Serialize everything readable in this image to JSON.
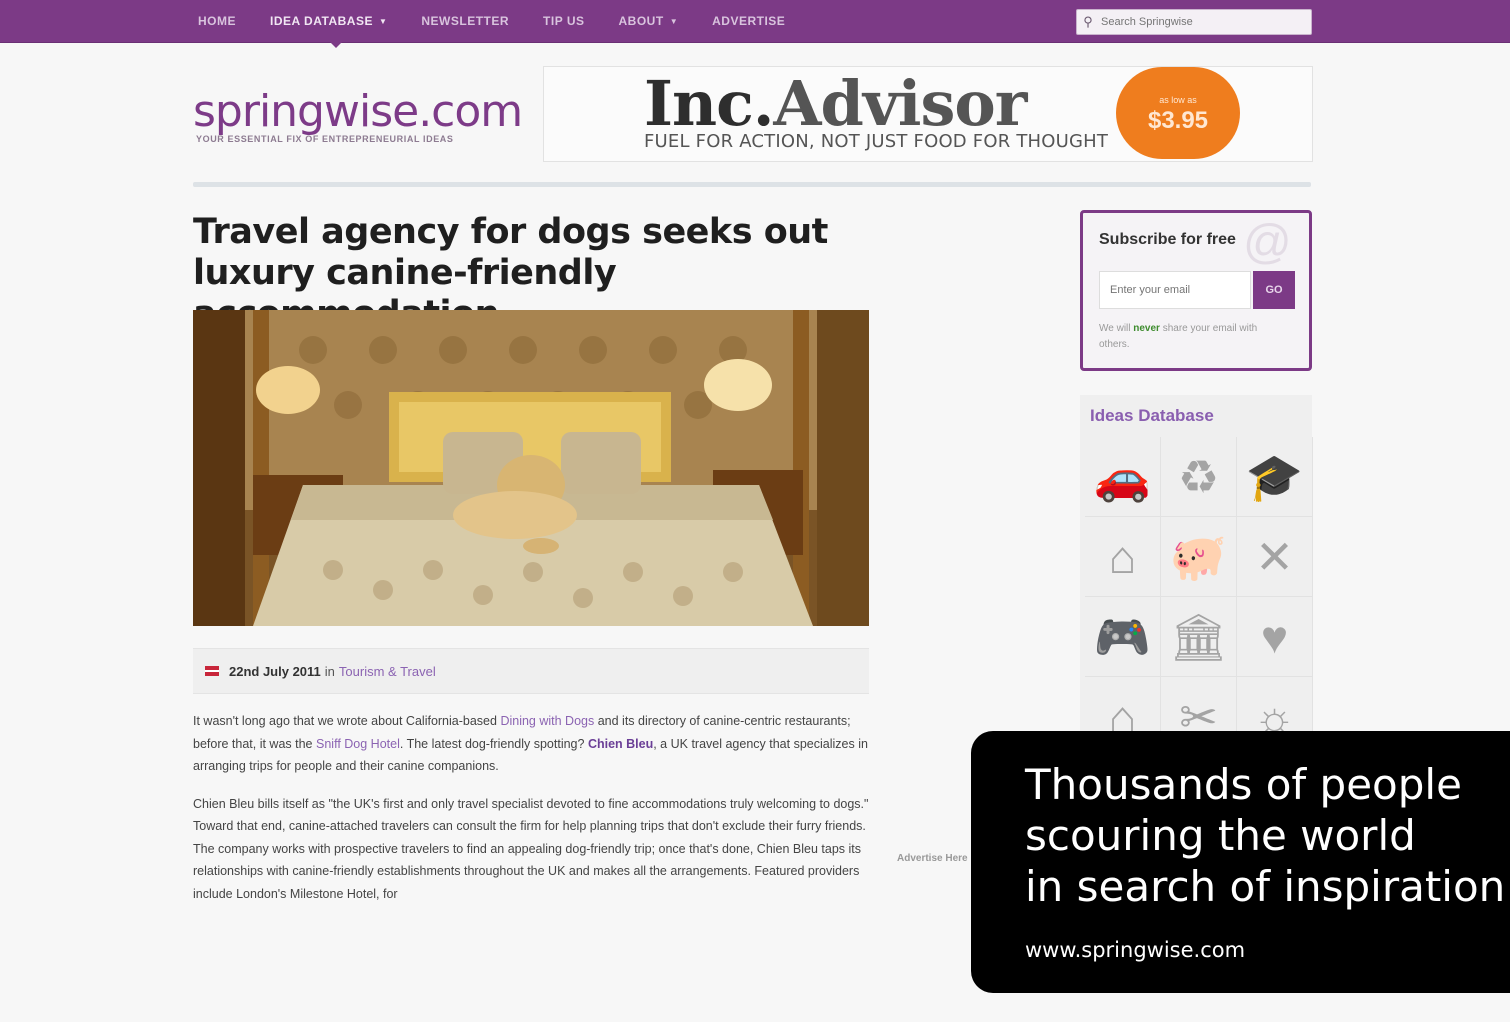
{
  "nav": {
    "items": [
      {
        "label": "HOME",
        "caret": false,
        "active": false
      },
      {
        "label": "IDEA DATABASE",
        "caret": true,
        "active": true
      },
      {
        "label": "NEWSLETTER",
        "caret": false,
        "active": false
      },
      {
        "label": "TIP US",
        "caret": false,
        "active": false
      },
      {
        "label": "ABOUT",
        "caret": true,
        "active": false
      },
      {
        "label": "ADVERTISE",
        "caret": false,
        "active": false
      }
    ],
    "search_placeholder": "Search Springwise"
  },
  "header": {
    "logo": "springwise.com",
    "tagline": "YOUR ESSENTIAL FIX OF ENTREPRENEURIAL IDEAS"
  },
  "ad": {
    "title_a": "Inc.",
    "title_b": "Advisor",
    "subtitle": "FUEL FOR ACTION, NOT JUST FOOD FOR THOUGHT",
    "badge_small": "as low as",
    "badge_price": "$3.95"
  },
  "article": {
    "title": "Travel agency for dogs seeks out luxury canine-friendly accommodation",
    "date": "22nd July 2011",
    "in": "in",
    "category": "Tourism & Travel",
    "p1": [
      {
        "t": "It wasn't long ago that we wrote about California-based "
      },
      {
        "t": "Dining with Dogs",
        "link": true
      },
      {
        "t": " and its directory of canine-centric restaurants; before that, it was the "
      },
      {
        "t": "Sniff Dog Hotel",
        "link": true
      },
      {
        "t": ". The latest dog-friendly spotting? "
      },
      {
        "t": "Chien Bleu",
        "link": true,
        "bold": true
      },
      {
        "t": ", a UK travel agency that specializes in arranging trips for people and their canine companions."
      }
    ],
    "p2": "Chien Bleu bills itself as \"the UK's first and only travel specialist devoted to fine accommodations truly welcoming to dogs.\" Toward that end, canine-attached travelers can consult the firm for help planning trips that don't exclude their furry friends. The company works with prospective travelers to find an appealing dog-friendly trip; once that's done, Chien Bleu taps its relationships with canine-friendly establishments throughout the UK and makes all the arrangements. Featured providers include London's Milestone Hotel, for"
  },
  "advertise_here": "Advertise Here",
  "subscribe": {
    "title": "Subscribe for free",
    "placeholder": "Enter your email",
    "go": "GO",
    "note_pre": "We will ",
    "note_bold": "never",
    "note_post": " share your email with others."
  },
  "ideas": {
    "title": "Ideas Database",
    "icons": [
      {
        "name": "car-icon",
        "glyph": "🚗"
      },
      {
        "name": "recycle-icon",
        "glyph": "♻"
      },
      {
        "name": "graduation-cap-icon",
        "glyph": "🎓"
      },
      {
        "name": "clothes-hanger-icon",
        "glyph": "⌂"
      },
      {
        "name": "piggy-bank-icon",
        "glyph": "🐖"
      },
      {
        "name": "fork-knife-icon",
        "glyph": "✕"
      },
      {
        "name": "gamepad-icon",
        "glyph": "🎮"
      },
      {
        "name": "bank-building-icon",
        "glyph": "🏛"
      },
      {
        "name": "heart-icon",
        "glyph": "♥"
      },
      {
        "name": "house-icon",
        "glyph": "⌂"
      },
      {
        "name": "scissors-icon",
        "glyph": "✂"
      },
      {
        "name": "sun-icon",
        "glyph": "☼"
      }
    ]
  },
  "overlay": {
    "headline": "Thousands of people\nscouring the world\nin search of inspiration",
    "url": "www.springwise.com"
  },
  "colors": {
    "brand": "#7c3a86",
    "link": "#8b63b2",
    "ad_orange": "#ef7d1e"
  }
}
